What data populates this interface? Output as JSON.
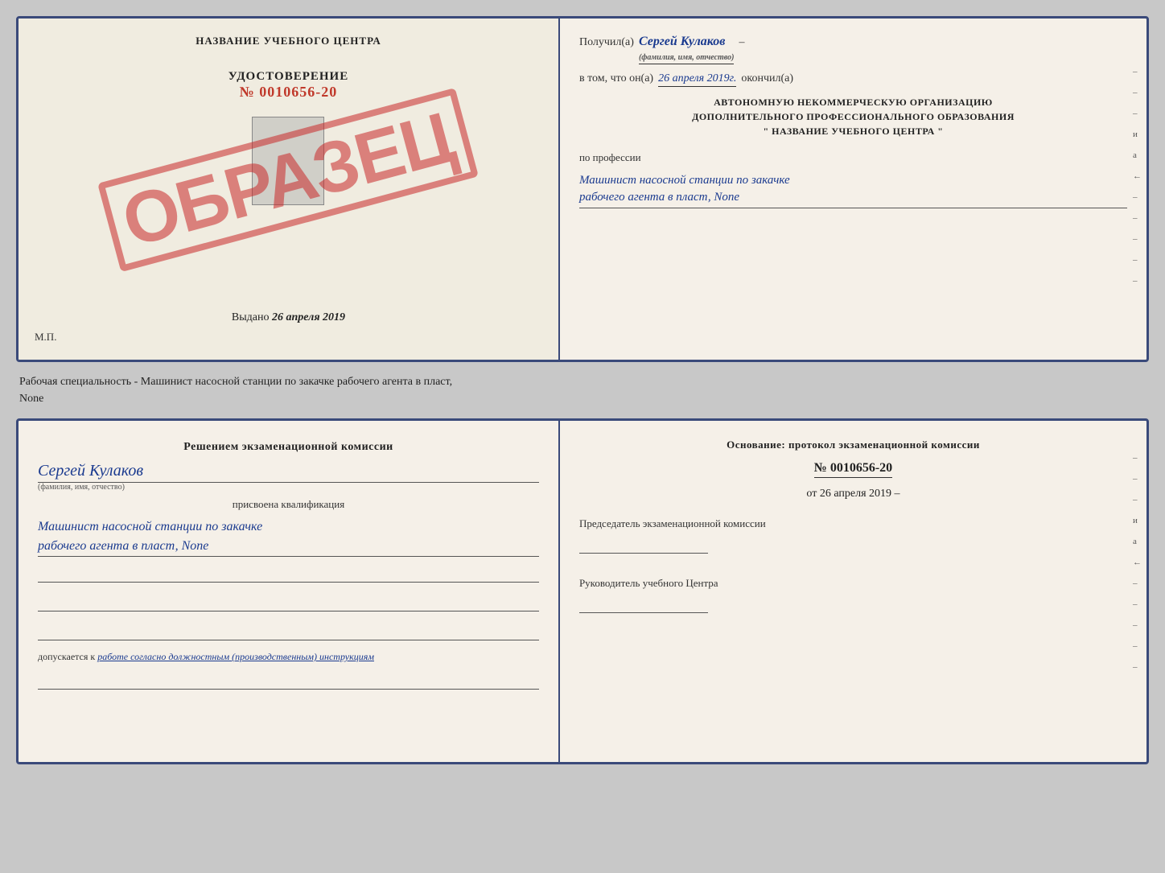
{
  "topDoc": {
    "left": {
      "title": "НАЗВАНИЕ УЧЕБНОГО ЦЕНТРА",
      "stampText": "ОБРАЗЕЦ",
      "certLabel": "УДОСТОВЕРЕНИЕ",
      "certNumber": "№ 0010656-20",
      "issuedPrefix": "Выдано",
      "issuedDate": "26 апреля 2019",
      "mpLabel": "М.П."
    },
    "right": {
      "recipientPrefix": "Получил(а)",
      "recipientName": "Сергей Кулаков",
      "recipientSubLabel": "(фамилия, имя, отчество)",
      "datePrefix": "в том, что он(а)",
      "date": "26 апреля 2019г.",
      "datePostfix": "окончил(а)",
      "orgLine1": "АВТОНОМНУЮ НЕКОММЕРЧЕСКУЮ ОРГАНИЗАЦИЮ",
      "orgLine2": "ДОПОЛНИТЕЛЬНОГО ПРОФЕССИОНАЛЬНОГО ОБРАЗОВАНИЯ",
      "orgLine3": "\"   НАЗВАНИЕ УЧЕБНОГО ЦЕНТРА   \"",
      "professionPrefix": "по профессии",
      "professionLine1": "Машинист насосной станции по закачке",
      "professionLine2": "рабочего агента в пласт, None",
      "sideMarks": [
        "-",
        "-",
        "-",
        "и",
        "а",
        "←",
        "-",
        "-",
        "-",
        "-",
        "-"
      ]
    }
  },
  "middleText": {
    "line1": "Рабочая специальность - Машинист насосной станции по закачке рабочего агента в пласт,",
    "line2": "None"
  },
  "bottomDoc": {
    "left": {
      "commissionTitle": "Решением экзаменационной комиссии",
      "personName": "Сергей Кулаков",
      "personSubLabel": "(фамилия, имя, отчество)",
      "qualificationLabel": "присвоена квалификация",
      "qualificationLine1": "Машинист насосной станции по закачке",
      "qualificationLine2": "рабочего агента в пласт, None",
      "allowedPrefix": "допускается к",
      "allowedValue": "работе согласно должностным (производственным) инструкциям"
    },
    "right": {
      "basisTitle": "Основание: протокол экзаменационной комиссии",
      "protocolNumber": "№ 0010656-20",
      "protocolDatePrefix": "от",
      "protocolDate": "26 апреля 2019",
      "chairmanTitle": "Председатель экзаменационной комиссии",
      "directorTitle": "Руководитель учебного Центра",
      "sideMarks": [
        "-",
        "-",
        "-",
        "и",
        "а",
        "←",
        "-",
        "-",
        "-",
        "-",
        "-"
      ]
    }
  }
}
